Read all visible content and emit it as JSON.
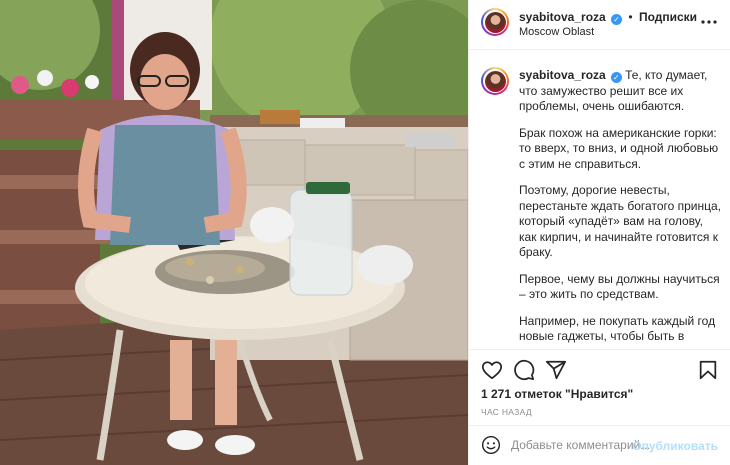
{
  "post": {
    "photo_alt": "Woman sitting at a garden table with coins, calculator and a glass jar",
    "author": {
      "username": "syabitova_roza",
      "verified": true,
      "location": "Moscow Oblast",
      "follow_label": "Подписки",
      "separator": "•",
      "more_label": "•••"
    },
    "caption": {
      "username": "syabitova_roza",
      "paragraphs": [
        "Те, кто думает, что замужество решит все их проблемы, очень ошибаются.",
        "Брак похож на американские горки: то вверх, то вниз, и одной любовью с этим не справиться.",
        "Поэтому, дорогие невесты, перестаньте ждать богатого принца, который «упадёт» вам на голову, как кирпич, и начинайте готовится к браку.",
        "Первое, чему вы должны научиться – это жить по средствам.",
        "Например, не покупать каждый год новые гаджеты, чтобы быть в тренде, а уметь покупать нормальную (желательно хорошую) технику."
      ]
    },
    "actions": {
      "icons": [
        "heart-icon",
        "comment-icon",
        "share-icon",
        "bookmark-icon"
      ]
    },
    "likes_text": "1 271 отметок \"Нравится\"",
    "time_ago": "ЧАС НАЗАД",
    "comment": {
      "placeholder": "Добавьте комментарий...",
      "value": "",
      "publish_label": "Опубликовать"
    },
    "colors": {
      "verified": "#3897f0",
      "publish_disabled": "#b2dffc",
      "text": "#262626",
      "muted": "#8e8e8e"
    }
  }
}
